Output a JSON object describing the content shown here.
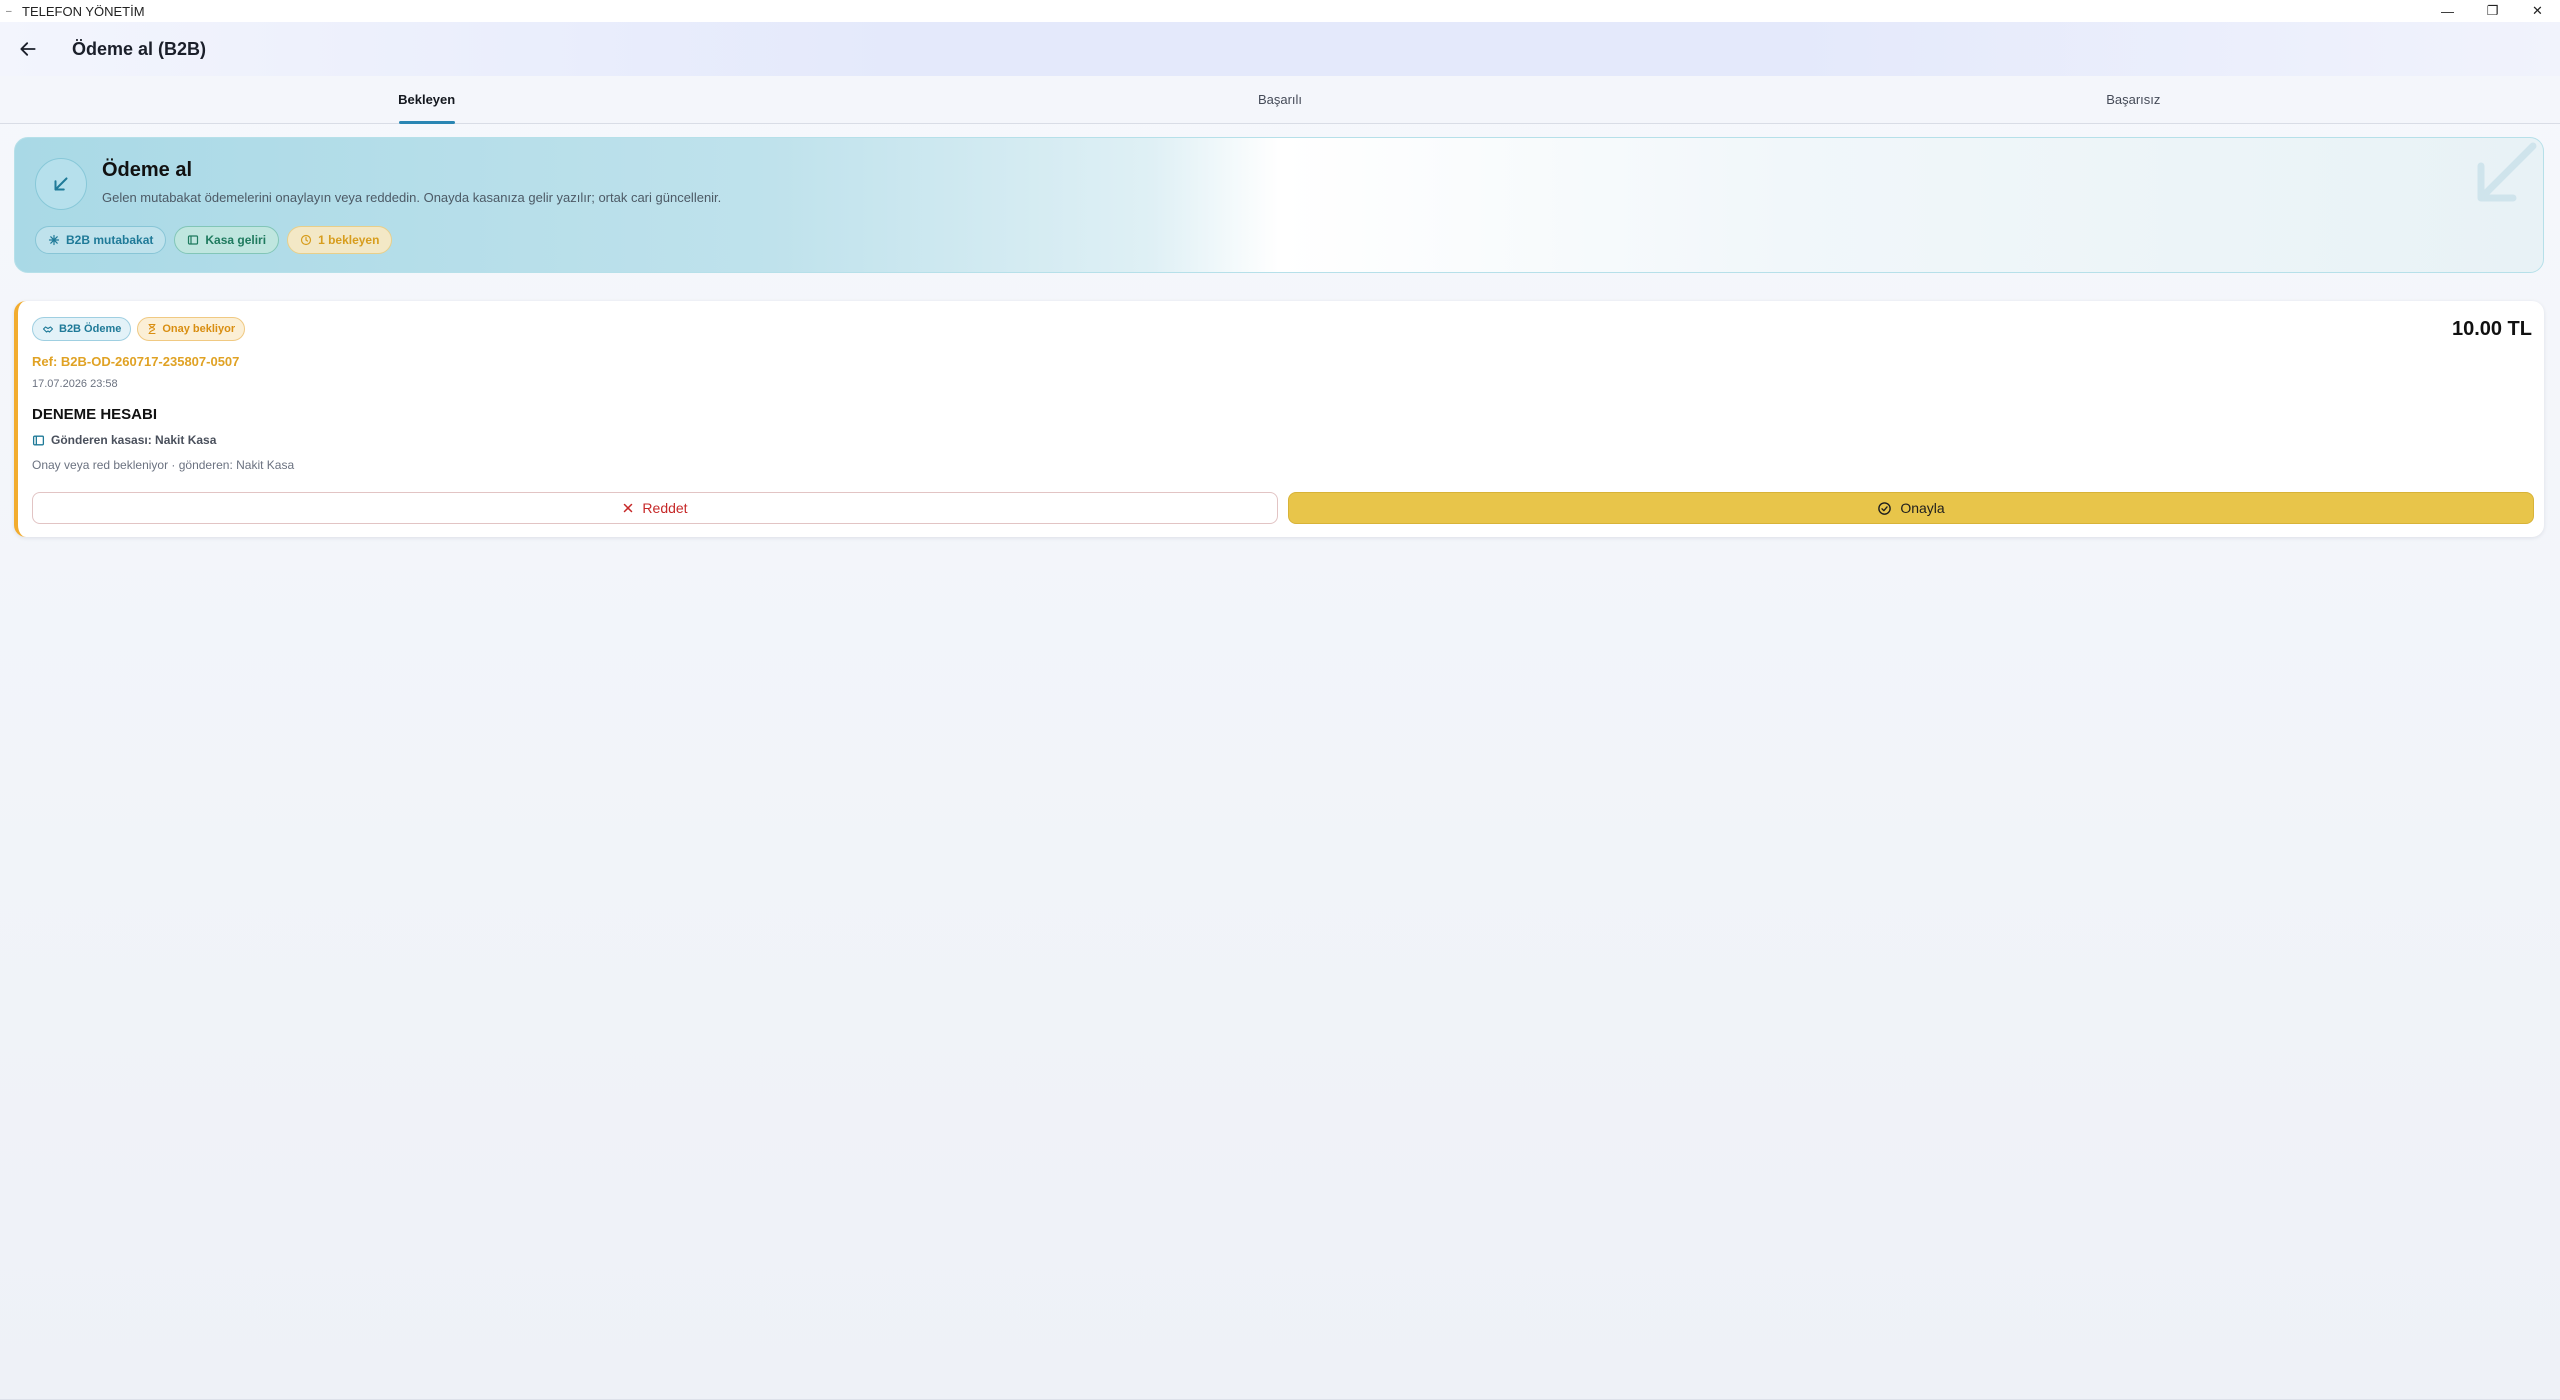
{
  "window": {
    "title": "TELEFON YÖNETİM",
    "controls": {
      "minimize": "—",
      "restore": "❐",
      "close": "✕"
    }
  },
  "appbar": {
    "back_icon": "arrow-left-icon",
    "title": "Ödeme al (B2B)"
  },
  "tabs": [
    {
      "label": "Bekleyen",
      "active": true
    },
    {
      "label": "Başarılı",
      "active": false
    },
    {
      "label": "Başarısız",
      "active": false
    }
  ],
  "hero": {
    "icon": "arrow-down-left-icon",
    "title": "Ödeme al",
    "subtitle": "Gelen mutabakat ödemelerini onaylayın veya reddedin. Onayda kasanıza gelir yazılır; ortak cari güncellenir.",
    "chips": [
      {
        "label": "B2B mutabakat",
        "icon": "hub-icon"
      },
      {
        "label": "Kasa geliri",
        "icon": "cashbox-icon"
      },
      {
        "label": "1 bekleyen",
        "icon": "clock-icon"
      }
    ]
  },
  "payment": {
    "badges": [
      {
        "label": "B2B Ödeme",
        "icon": "handshake-icon"
      },
      {
        "label": "Onay bekliyor",
        "icon": "hourglass-icon"
      }
    ],
    "amount": "10.00 TL",
    "ref": "Ref: B2B-OD-260717-235807-0507",
    "date": "17.07.2026 23:58",
    "account": "DENEME HESABI",
    "sender": "Gönderen kasası: Nakit Kasa",
    "note": "Onay veya red bekleniyor · gönderen: Nakit Kasa",
    "reject_label": "Reddet",
    "approve_label": "Onayla"
  },
  "colors": {
    "accent": "#2a86b3",
    "pending": "#f2ac2e",
    "approve": "#e8c54a",
    "reject": "#c62828"
  }
}
